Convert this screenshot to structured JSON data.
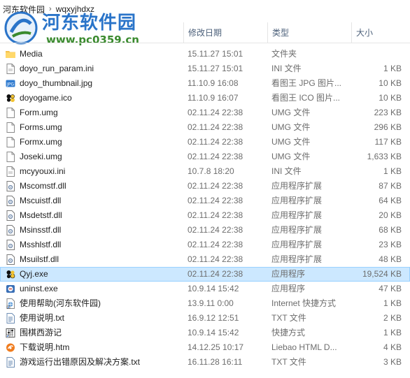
{
  "breadcrumb": {
    "parent": "河东软件园",
    "current": "wqxyjhdxz"
  },
  "watermark": {
    "title": "河东软件园",
    "url": "www.pc0359.cn"
  },
  "columns": {
    "date": "修改日期",
    "type": "类型",
    "size": "大小"
  },
  "files": [
    {
      "name": "Media",
      "date": "15.11.27 15:01",
      "type": "文件夹",
      "size": "",
      "icon": "folder-icon"
    },
    {
      "name": "doyo_run_param.ini",
      "date": "15.11.27 15:01",
      "type": "INI 文件",
      "size": "1 KB",
      "icon": "ini-file-icon"
    },
    {
      "name": "doyo_thumbnail.jpg",
      "date": "11.10.9 16:08",
      "type": "看图王 JPG 图片...",
      "size": "10 KB",
      "icon": "jpg-file-icon"
    },
    {
      "name": "doyogame.ico",
      "date": "11.10.9 16:07",
      "type": "看图王 ICO 图片...",
      "size": "10 KB",
      "icon": "ico-file-icon"
    },
    {
      "name": "Form.umg",
      "date": "02.11.24 22:38",
      "type": "UMG 文件",
      "size": "223 KB",
      "icon": "file-icon"
    },
    {
      "name": "Forms.umg",
      "date": "02.11.24 22:38",
      "type": "UMG 文件",
      "size": "296 KB",
      "icon": "file-icon"
    },
    {
      "name": "Formx.umg",
      "date": "02.11.24 22:38",
      "type": "UMG 文件",
      "size": "117 KB",
      "icon": "file-icon"
    },
    {
      "name": "Joseki.umg",
      "date": "02.11.24 22:38",
      "type": "UMG 文件",
      "size": "1,633 KB",
      "icon": "file-icon"
    },
    {
      "name": "mcyyouxi.ini",
      "date": "10.7.8 18:20",
      "type": "INI 文件",
      "size": "1 KB",
      "icon": "ini-file-icon"
    },
    {
      "name": "Mscomstf.dll",
      "date": "02.11.24 22:38",
      "type": "应用程序扩展",
      "size": "87 KB",
      "icon": "dll-file-icon"
    },
    {
      "name": "Mscuistf.dll",
      "date": "02.11.24 22:38",
      "type": "应用程序扩展",
      "size": "64 KB",
      "icon": "dll-file-icon"
    },
    {
      "name": "Msdetstf.dll",
      "date": "02.11.24 22:38",
      "type": "应用程序扩展",
      "size": "20 KB",
      "icon": "dll-file-icon"
    },
    {
      "name": "Msinsstf.dll",
      "date": "02.11.24 22:38",
      "type": "应用程序扩展",
      "size": "68 KB",
      "icon": "dll-file-icon"
    },
    {
      "name": "Msshlstf.dll",
      "date": "02.11.24 22:38",
      "type": "应用程序扩展",
      "size": "23 KB",
      "icon": "dll-file-icon"
    },
    {
      "name": "Msuilstf.dll",
      "date": "02.11.24 22:38",
      "type": "应用程序扩展",
      "size": "48 KB",
      "icon": "dll-file-icon"
    },
    {
      "name": "Qyj.exe",
      "date": "02.11.24 22:38",
      "type": "应用程序",
      "size": "19,524 KB",
      "icon": "game-exe-icon",
      "selected": true
    },
    {
      "name": "uninst.exe",
      "date": "10.9.14 15:42",
      "type": "应用程序",
      "size": "47 KB",
      "icon": "uninstall-icon"
    },
    {
      "name": "使用帮助(河东软件园)",
      "date": "13.9.11 0:00",
      "type": "Internet 快捷方式",
      "size": "1 KB",
      "icon": "internet-shortcut-icon"
    },
    {
      "name": "使用说明.txt",
      "date": "16.9.12 12:51",
      "type": "TXT 文件",
      "size": "2 KB",
      "icon": "txt-file-icon"
    },
    {
      "name": "围棋西游记",
      "date": "10.9.14 15:42",
      "type": "快捷方式",
      "size": "1 KB",
      "icon": "shortcut-icon"
    },
    {
      "name": "下载说明.htm",
      "date": "14.12.25 10:17",
      "type": "Liebao HTML D...",
      "size": "4 KB",
      "icon": "htm-file-icon"
    },
    {
      "name": "游戏运行出错原因及解决方案.txt",
      "date": "16.11.28 16:11",
      "type": "TXT 文件",
      "size": "3 KB",
      "icon": "txt-file-icon"
    }
  ]
}
